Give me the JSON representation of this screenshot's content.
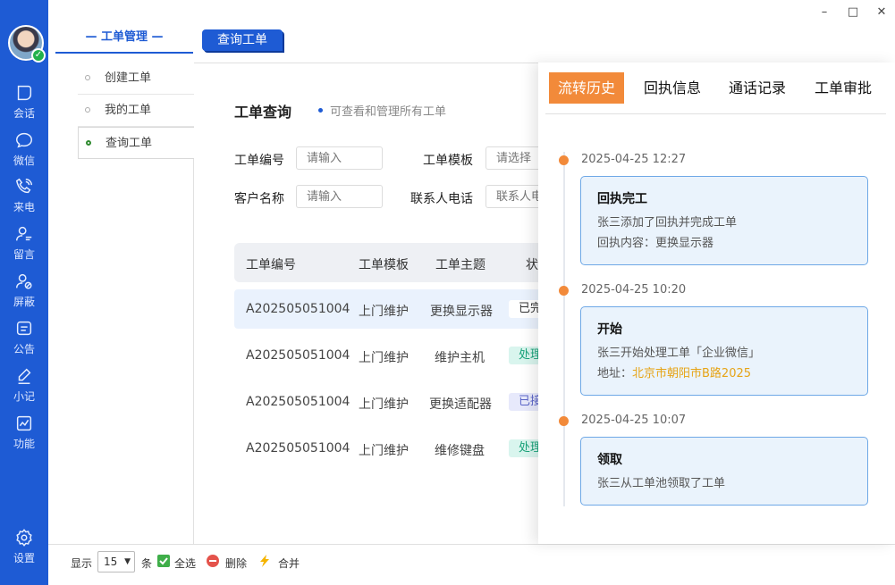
{
  "window": {
    "minimize": "–",
    "maximize": "□",
    "close": "✕"
  },
  "leftnav": {
    "items": [
      {
        "label": "会话",
        "icon": "chat-bubble-icon"
      },
      {
        "label": "微信",
        "icon": "wechat-icon"
      },
      {
        "label": "来电",
        "icon": "phone-icon"
      },
      {
        "label": "留言",
        "icon": "message-user-icon"
      },
      {
        "label": "屏蔽",
        "icon": "block-user-icon"
      },
      {
        "label": "公告",
        "icon": "notice-icon"
      },
      {
        "label": "小记",
        "icon": "pen-icon"
      },
      {
        "label": "功能",
        "icon": "chart-icon"
      },
      {
        "label": "设置",
        "icon": "gear-icon"
      }
    ],
    "avatar_status": "✓"
  },
  "header": {
    "section_title": "— 工单管理 —",
    "active_tab": "查询工单"
  },
  "sidemenu": {
    "items": [
      {
        "label": "创建工单"
      },
      {
        "label": "我的工单"
      },
      {
        "label": "查询工单"
      }
    ]
  },
  "main": {
    "title": "工单查询",
    "hint": "可查看和管理所有工单",
    "form": {
      "order_no_label": "工单编号",
      "order_no_placeholder": "请输入",
      "template_label": "工单模板",
      "template_placeholder": "请选择",
      "customer_label": "客户名称",
      "customer_placeholder": "请输入",
      "contact_phone_label": "联系人电话",
      "contact_phone_placeholder": "联系人电话"
    },
    "table": {
      "headers": [
        "工单编号",
        "工单模板",
        "工单主题",
        "状"
      ],
      "rows": [
        {
          "no": "A202505051004",
          "template": "上门维护",
          "subject": "更换显示器",
          "status": "已完"
        },
        {
          "no": "A202505051004",
          "template": "上门维护",
          "subject": "维护主机",
          "status": "处理"
        },
        {
          "no": "A202505051004",
          "template": "上门维护",
          "subject": "更换适配器",
          "status": "已接"
        },
        {
          "no": "A202505051004",
          "template": "上门维护",
          "subject": "维修键盘",
          "status": "处理"
        }
      ]
    }
  },
  "bottombar": {
    "show_label": "显示",
    "page_size": "15",
    "unit_label": "条",
    "select_all": "全选",
    "delete": "删除",
    "merge": "合并"
  },
  "panel": {
    "tabs": [
      "流转历史",
      "回执信息",
      "通话记录",
      "工单审批"
    ],
    "events": [
      {
        "time": "2025-04-25 12:27",
        "title": "回执完工",
        "line1": "张三添加了回执并完成工单",
        "line2": "回执内容：更换显示器"
      },
      {
        "time": "2025-04-25 10:20",
        "title": "开始",
        "line1": "张三开始处理工单「企业微信」",
        "addr_label": "地址：",
        "addr_value": "北京市朝阳市B路2025"
      },
      {
        "time": "2025-04-25 10:07",
        "title": "领取",
        "line1": "张三从工单池领取了工单"
      }
    ]
  },
  "colors": {
    "primary": "#1e5bd4",
    "accent": "#f28a3a",
    "address": "#e6a417"
  }
}
